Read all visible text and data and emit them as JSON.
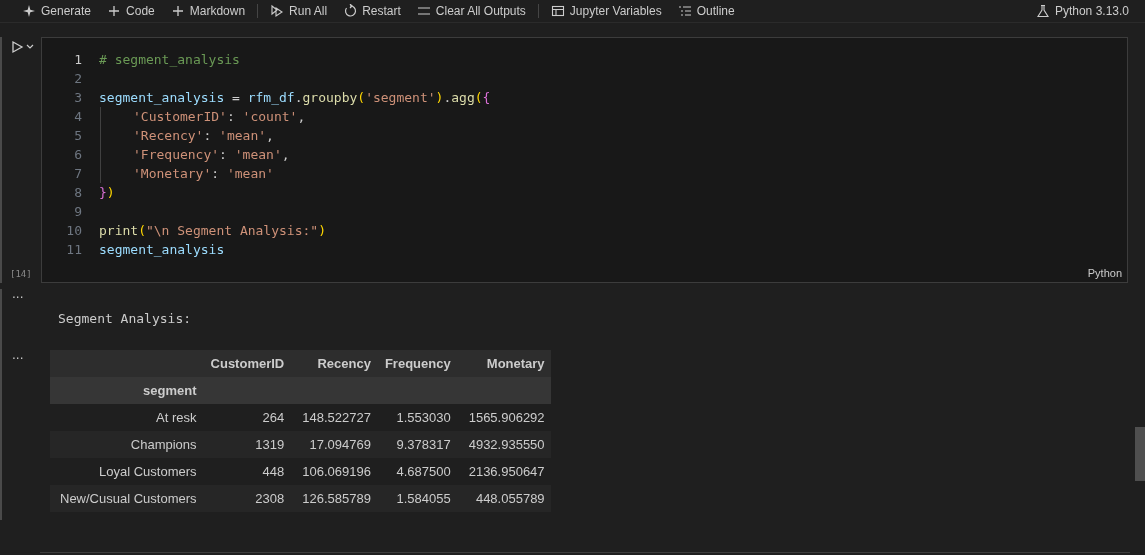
{
  "toolbar": {
    "groups": [
      [
        {
          "kind": "sparkle",
          "label": "Generate"
        },
        {
          "kind": "plus",
          "label": "Code"
        },
        {
          "kind": "plus",
          "label": "Markdown"
        }
      ],
      [
        {
          "kind": "run-all",
          "label": "Run All"
        },
        {
          "kind": "restart",
          "label": "Restart"
        },
        {
          "kind": "clear",
          "label": "Clear All Outputs"
        }
      ],
      [
        {
          "kind": "variables",
          "label": "Jupyter Variables"
        },
        {
          "kind": "outline",
          "label": "Outline"
        }
      ]
    ],
    "kernel": "Python 3.13.0"
  },
  "cell": {
    "execution_count": "[14]",
    "language": "Python",
    "lines": [
      {
        "number": "1",
        "active": true,
        "indented": false,
        "tokens": [
          {
            "kind": "comment",
            "text": "# segment_analysis"
          }
        ]
      },
      {
        "number": "2",
        "active": false,
        "indented": false
      },
      {
        "number": "3",
        "active": false,
        "indented": false,
        "tokens": [
          {
            "kind": "var",
            "text": "segment_analysis"
          },
          {
            "kind": "plain",
            "text": " = "
          },
          {
            "kind": "var",
            "text": "rfm_df"
          },
          {
            "kind": "plain",
            "text": "."
          },
          {
            "kind": "func",
            "text": "groupby"
          },
          {
            "kind": "bracket1",
            "text": "("
          },
          {
            "kind": "string",
            "text": "'segment'"
          },
          {
            "kind": "bracket1",
            "text": ")"
          },
          {
            "kind": "plain",
            "text": "."
          },
          {
            "kind": "func",
            "text": "agg"
          },
          {
            "kind": "bracket1",
            "text": "("
          },
          {
            "kind": "bracket2",
            "text": "{"
          }
        ]
      },
      {
        "number": "4",
        "active": false,
        "indented": true,
        "tokens": [
          {
            "kind": "string",
            "text": "'CustomerID'"
          },
          {
            "kind": "plain",
            "text": ": "
          },
          {
            "kind": "string",
            "text": "'count'"
          },
          {
            "kind": "plain",
            "text": ","
          }
        ]
      },
      {
        "number": "5",
        "active": false,
        "indented": true,
        "tokens": [
          {
            "kind": "string",
            "text": "'Recency'"
          },
          {
            "kind": "plain",
            "text": ": "
          },
          {
            "kind": "string",
            "text": "'mean'"
          },
          {
            "kind": "plain",
            "text": ","
          }
        ]
      },
      {
        "number": "6",
        "active": false,
        "indented": true,
        "tokens": [
          {
            "kind": "string",
            "text": "'Frequency'"
          },
          {
            "kind": "plain",
            "text": ": "
          },
          {
            "kind": "string",
            "text": "'mean'"
          },
          {
            "kind": "plain",
            "text": ","
          }
        ]
      },
      {
        "number": "7",
        "active": false,
        "indented": true,
        "tokens": [
          {
            "kind": "string",
            "text": "'Monetary'"
          },
          {
            "kind": "plain",
            "text": ": "
          },
          {
            "kind": "string",
            "text": "'mean'"
          }
        ]
      },
      {
        "number": "8",
        "active": false,
        "indented": false,
        "tokens": [
          {
            "kind": "bracket2",
            "text": "}"
          },
          {
            "kind": "bracket1",
            "text": ")"
          }
        ]
      },
      {
        "number": "9",
        "active": false,
        "indented": false
      },
      {
        "number": "10",
        "active": false,
        "indented": false,
        "tokens": [
          {
            "kind": "func",
            "text": "print"
          },
          {
            "kind": "bracket1",
            "text": "("
          },
          {
            "kind": "string",
            "text": "\"\\n Segment Analysis:\""
          },
          {
            "kind": "bracket1",
            "text": ")"
          }
        ]
      },
      {
        "number": "11",
        "active": false,
        "indented": false,
        "tokens": [
          {
            "kind": "var",
            "text": "segment_analysis"
          }
        ]
      }
    ]
  },
  "outputs": [
    {
      "kind": "text",
      "marker": "...",
      "text": "Segment Analysis:"
    },
    {
      "kind": "table",
      "marker": "...",
      "columns": [
        "CustomerID",
        "Recency",
        "Frequency",
        "Monetary"
      ],
      "index_name": "segment",
      "rows": [
        {
          "index": "At resk",
          "cells": [
            "264",
            "148.522727",
            "1.553030",
            "1565.906292"
          ]
        },
        {
          "index": "Champions",
          "cells": [
            "1319",
            "17.094769",
            "9.378317",
            "4932.935550"
          ]
        },
        {
          "index": "Loyal Customers",
          "cells": [
            "448",
            "106.069196",
            "4.687500",
            "2136.950647"
          ]
        },
        {
          "index": "New/Cusual Customers",
          "cells": [
            "2308",
            "126.585789",
            "1.584055",
            "448.055789"
          ]
        }
      ]
    }
  ]
}
